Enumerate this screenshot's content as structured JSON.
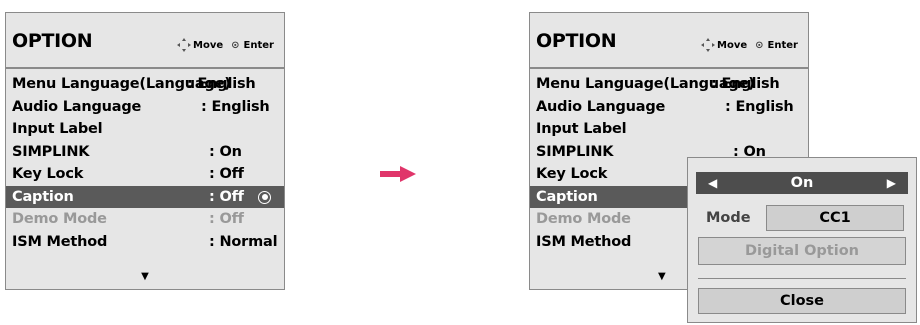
{
  "left_panel": {
    "title": "OPTION",
    "hints": {
      "move": "Move",
      "enter": "Enter"
    },
    "items": [
      {
        "label": "Menu Language(Language)",
        "value": ": English",
        "state": "normal"
      },
      {
        "label": "Audio Language",
        "value": ": English",
        "state": "normal"
      },
      {
        "label": "Input Label",
        "value": "",
        "state": "normal"
      },
      {
        "label": "SIMPLINK",
        "value": ": On",
        "state": "normal"
      },
      {
        "label": "Key Lock",
        "value": ": Off",
        "state": "normal"
      },
      {
        "label": "Caption",
        "value": ": Off",
        "state": "selected"
      },
      {
        "label": "Demo Mode",
        "value": ": Off",
        "state": "disabled"
      },
      {
        "label": "ISM Method",
        "value": ": Normal",
        "state": "normal"
      }
    ],
    "more_icon": "down-triangle"
  },
  "right_panel": {
    "title": "OPTION",
    "hints": {
      "move": "Move",
      "enter": "Enter"
    },
    "items": [
      {
        "label": "Menu Language(Language)",
        "value": ": English",
        "state": "normal"
      },
      {
        "label": "Audio Language",
        "value": ": English",
        "state": "normal"
      },
      {
        "label": "Input Label",
        "value": "",
        "state": "normal"
      },
      {
        "label": "SIMPLINK",
        "value": ": On",
        "state": "normal"
      },
      {
        "label": "Key Lock",
        "value": "",
        "state": "normal"
      },
      {
        "label": "Caption",
        "value": "",
        "state": "selected"
      },
      {
        "label": "Demo Mode",
        "value": "",
        "state": "disabled"
      },
      {
        "label": "ISM Method",
        "value": "",
        "state": "normal"
      }
    ]
  },
  "transition_arrow_color": "#e0356a",
  "caption_popup": {
    "selector_value": "On",
    "mode_label": "Mode",
    "mode_value": "CC1",
    "digital_option": "Digital Option",
    "close_label": "Close"
  }
}
